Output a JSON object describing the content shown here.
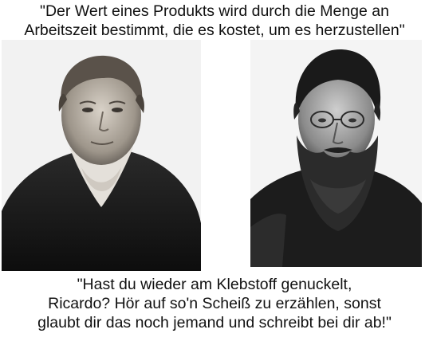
{
  "top_quote": {
    "lines": [
      "\"Der Wert eines Produkts wird durch die Menge an",
      "Arbeitszeit bestimmt, die es kostet, um es herzustellen\""
    ]
  },
  "bottom_quote": {
    "lines": [
      "\"Hast du wieder am Klebstoff genuckelt,",
      "Ricardo? Hör auf so'n Scheiß zu erzählen, sonst",
      "glaubt dir das noch jemand und schreibt bei dir ab!\""
    ]
  },
  "portraits": [
    {
      "icon": "portrait-clean-shaven-man-icon"
    },
    {
      "icon": "portrait-bearded-man-glasses-icon"
    }
  ],
  "colors": {
    "background": "#ffffff",
    "text": "#111111"
  }
}
